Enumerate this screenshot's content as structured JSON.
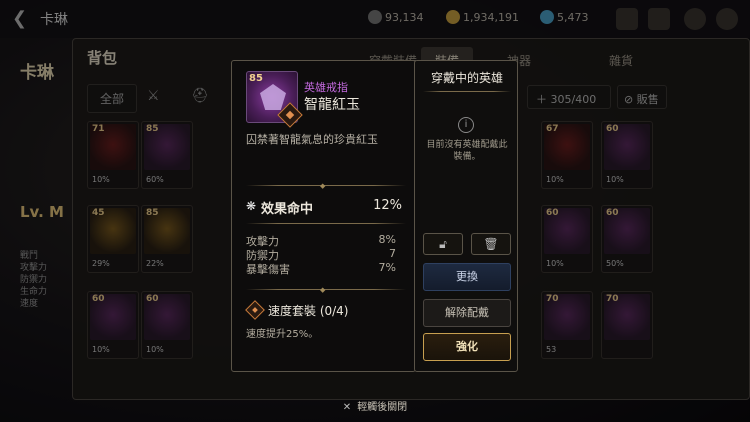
{
  "topbar": {
    "back_icon": "chevron-left-icon",
    "title": "卡琳",
    "currencies": [
      "93,134",
      "1,934,191",
      "5,473"
    ]
  },
  "hero": {
    "name": "卡琳",
    "level_label": "Lv. M",
    "stats_header": "戰鬥",
    "stat_labels": [
      "攻擊力",
      "防禦力",
      "生命力",
      "速度"
    ]
  },
  "bag": {
    "title": "背包",
    "tabs": [
      "穿戴裝備",
      "裝備",
      "神器",
      "雜貨"
    ],
    "filter_all": "全部",
    "count": "305/400",
    "sell": "販售",
    "slots": [
      {
        "lvl": "71",
        "stat": "10%"
      },
      {
        "lvl": "85",
        "stat": "60%"
      },
      {
        "lvl": "67",
        "stat": "10%"
      },
      {
        "lvl": "60",
        "stat": "10%"
      },
      {
        "lvl": "45",
        "stat": "29%"
      },
      {
        "lvl": "85",
        "stat": "22%"
      },
      {
        "lvl": "60",
        "stat": "10%"
      },
      {
        "lvl": "60",
        "stat": "50%"
      },
      {
        "lvl": "60",
        "stat": "10%"
      },
      {
        "lvl": "60",
        "stat": "10%"
      },
      {
        "lvl": "70",
        "stat": "53"
      },
      {
        "lvl": "70",
        "stat": ""
      }
    ]
  },
  "item": {
    "level": "85",
    "type": "英雄戒指",
    "name": "智龍紅玉",
    "description": "囚禁著智龍氣息的珍貴紅玉",
    "main_stat": {
      "label": "效果命中",
      "value": "12%"
    },
    "sub_stats": [
      {
        "label": "攻擊力",
        "value": "8%"
      },
      {
        "label": "防禦力",
        "value": "7"
      },
      {
        "label": "暴擊傷害",
        "value": "7%"
      }
    ],
    "set": {
      "label": "速度套裝 (0/4)",
      "description": "速度提升25%。"
    }
  },
  "equip": {
    "title": "穿戴中的英雄",
    "message": "目前沒有英雄配戴此裝備。",
    "lock_icon": "unlock-icon",
    "trash_icon": "trash-icon",
    "buttons": {
      "replace": "更換",
      "unequip": "解除配戴",
      "enhance": "強化"
    }
  },
  "hint": "輕觸後關閉",
  "colors": {
    "rarity_purple": "#c46adf",
    "gold": "#c8a050"
  }
}
